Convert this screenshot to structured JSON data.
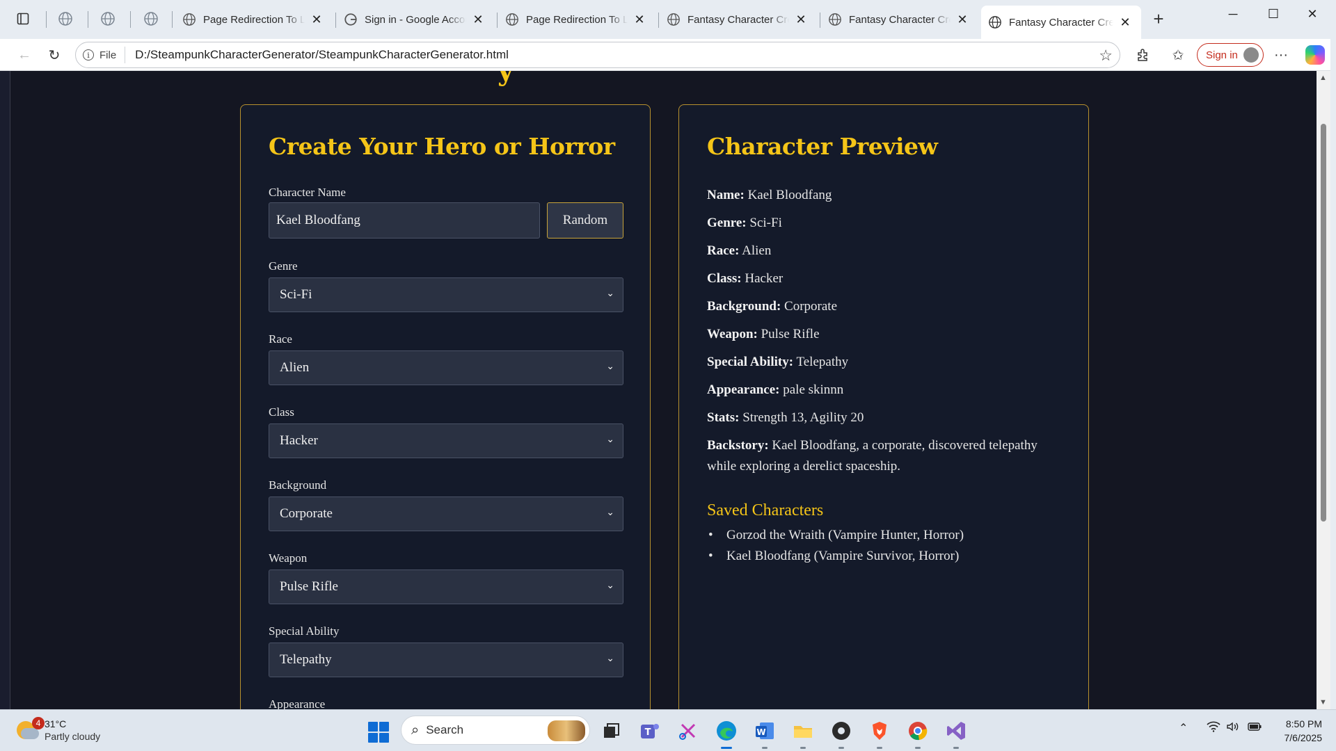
{
  "browser": {
    "tabs": [
      {
        "title": "Page Redirection To Lo",
        "active": false
      },
      {
        "title": "Sign in - Google Accou",
        "active": false
      },
      {
        "title": "Page Redirection To Lo",
        "active": false
      },
      {
        "title": "Fantasy Character Creat",
        "active": false
      },
      {
        "title": "Fantasy Character Creat",
        "active": false
      },
      {
        "title": "Fantasy Character Creat",
        "active": true
      }
    ],
    "site_info_label": "File",
    "url": "D:/SteampunkCharacterGenerator/SteampunkCharacterGenerator.html",
    "signin_label": "Sign in"
  },
  "form": {
    "title": "Create Your Hero or Horror",
    "name_label": "Character Name",
    "name_value": "Kael Bloodfang",
    "random_label": "Random",
    "fields": [
      {
        "label": "Genre",
        "value": "Sci-Fi"
      },
      {
        "label": "Race",
        "value": "Alien"
      },
      {
        "label": "Class",
        "value": "Hacker"
      },
      {
        "label": "Background",
        "value": "Corporate"
      },
      {
        "label": "Weapon",
        "value": "Pulse Rifle"
      },
      {
        "label": "Special Ability",
        "value": "Telepathy"
      }
    ],
    "next_label": "Appearance"
  },
  "preview": {
    "title": "Character Preview",
    "rows": [
      {
        "key": "Name:",
        "value": "Kael Bloodfang"
      },
      {
        "key": "Genre:",
        "value": "Sci-Fi"
      },
      {
        "key": "Race:",
        "value": "Alien"
      },
      {
        "key": "Class:",
        "value": "Hacker"
      },
      {
        "key": "Background:",
        "value": "Corporate"
      },
      {
        "key": "Weapon:",
        "value": "Pulse Rifle"
      },
      {
        "key": "Special Ability:",
        "value": "Telepathy"
      },
      {
        "key": "Appearance:",
        "value": "pale skinnn"
      },
      {
        "key": "Stats:",
        "value": "Strength 13, Agility 20"
      }
    ],
    "backstory_key": "Backstory:",
    "backstory_value": "Kael Bloodfang, a corporate, discovered telepathy while exploring a derelict spaceship.",
    "saved_title": "Saved Characters",
    "saved": [
      "Gorzod the Wraith (Vampire Hunter, Horror)",
      "Kael Bloodfang (Vampire Survivor, Horror)"
    ]
  },
  "taskbar": {
    "weather_badge": "4",
    "temperature": "31°C",
    "condition": "Partly cloudy",
    "search_placeholder": "Search",
    "time": "8:50 PM",
    "date": "7/6/2025"
  },
  "colors": {
    "accent_gold": "#f5c518",
    "panel_border": "#b8912e",
    "page_bg": "#141622",
    "input_bg": "#2a3142"
  }
}
